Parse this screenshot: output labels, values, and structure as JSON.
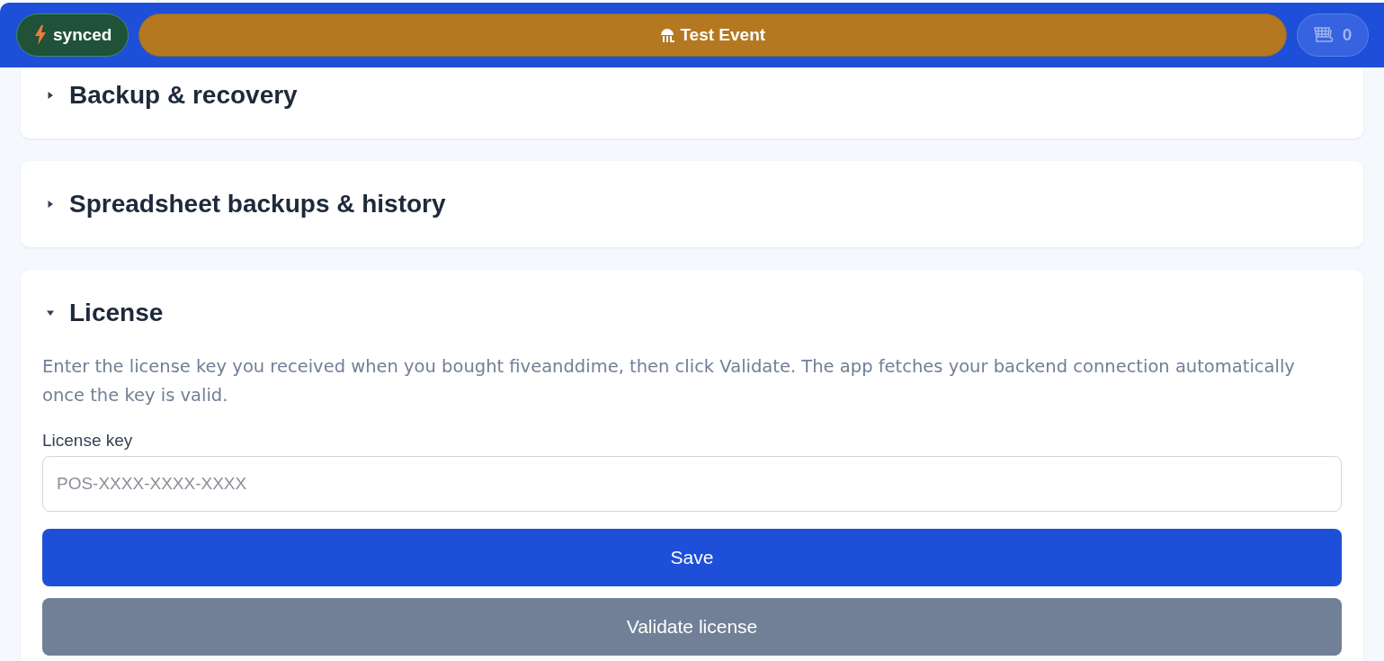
{
  "header": {
    "sync": {
      "label": "synced"
    },
    "event": {
      "label": "Test Event"
    },
    "cart": {
      "count": "0",
      "disabled": true
    }
  },
  "sections": [
    {
      "title": "Backup & recovery",
      "expanded": false
    },
    {
      "title": "Spreadsheet backups & history",
      "expanded": false
    },
    {
      "title": "License",
      "expanded": true,
      "description": "Enter the license key you received when you bought fiveanddime, then click Validate. The app fetches your backend connection automatically once the key is valid.",
      "field": {
        "label": "License key",
        "placeholder": "POS-XXXX-XXXX-XXXX"
      },
      "buttons": [
        {
          "label": "Save",
          "kind": "primary"
        },
        {
          "label": "Validate license",
          "kind": "secondary"
        }
      ]
    }
  ]
}
